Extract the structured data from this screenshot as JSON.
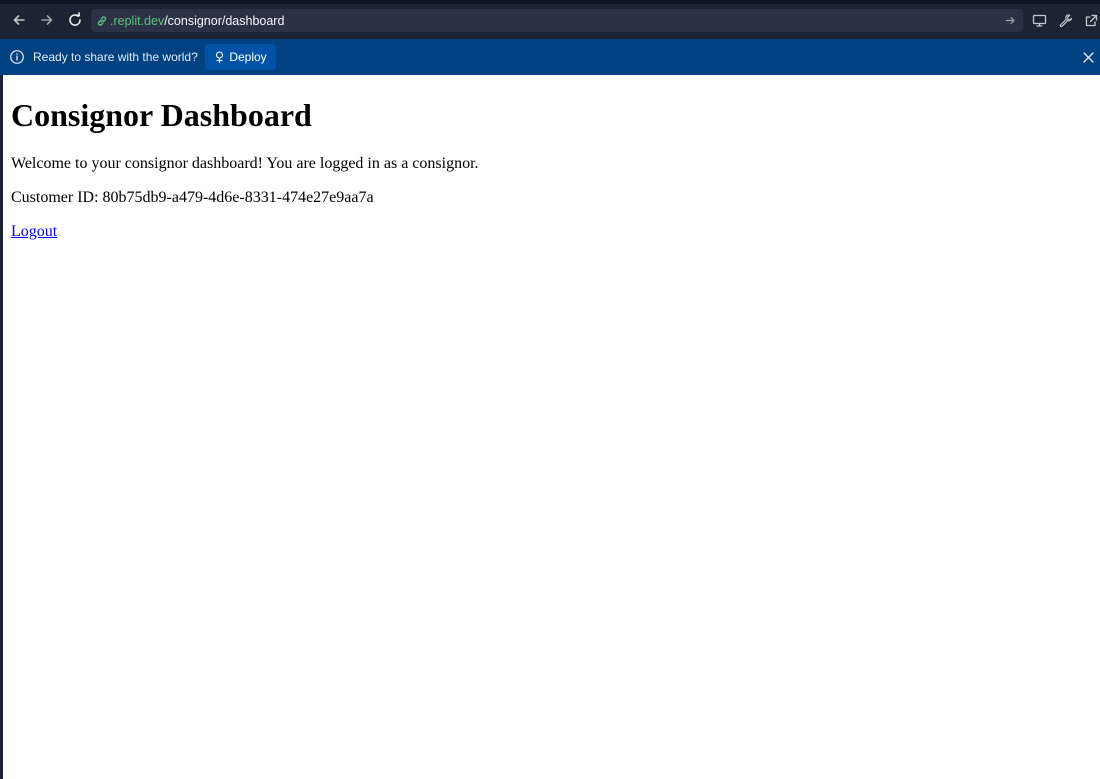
{
  "browser": {
    "url_domain": ".replit.dev",
    "url_path": "/consignor/dashboard",
    "icons": {
      "back": "arrow-left-icon",
      "forward": "arrow-right-icon",
      "reload": "reload-icon",
      "link": "link-icon",
      "go": "arrow-right-icon",
      "devices": "monitor-icon",
      "devtools": "wrench-icon",
      "open_external": "external-link-icon"
    }
  },
  "banner": {
    "message": "Ready to share with the world?",
    "deploy_label": "Deploy",
    "colors": {
      "background": "#004182",
      "button": "#0053a6"
    }
  },
  "page": {
    "title": "Consignor Dashboard",
    "welcome_text": "Welcome to your consignor dashboard! You are logged in as a consignor.",
    "customer_id_text": "Customer ID: 80b75db9-a479-4d6e-8331-474e27e9aa7a",
    "logout_label": "Logout"
  }
}
